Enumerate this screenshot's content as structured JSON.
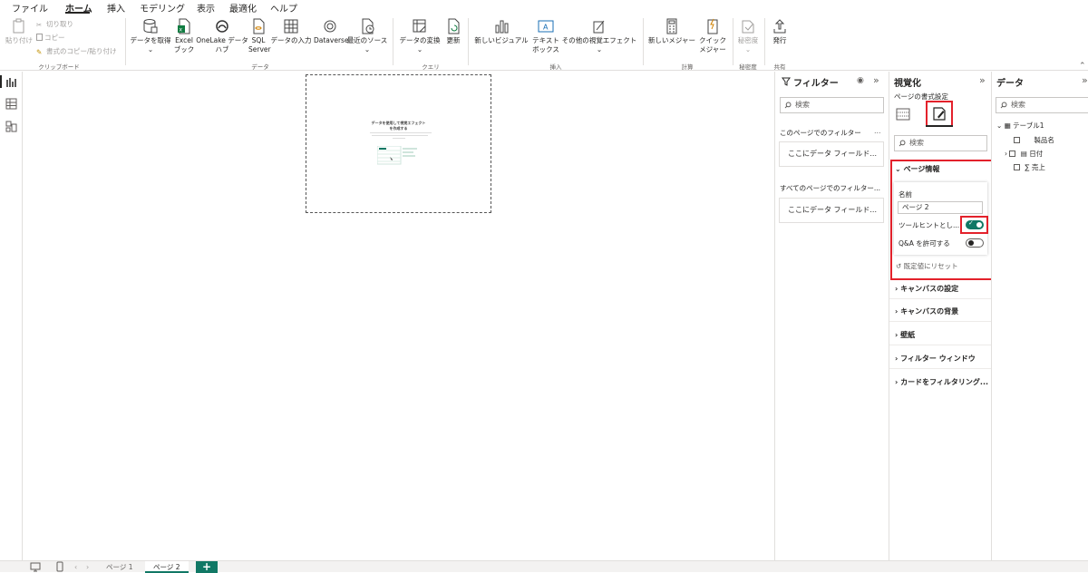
{
  "menu": {
    "items": [
      "ファイル",
      "ホーム",
      "挿入",
      "モデリング",
      "表示",
      "最適化",
      "ヘルプ"
    ],
    "active": "ホーム"
  },
  "ribbon": {
    "clipboard": {
      "paste_label": "貼り付け",
      "cut_label": "切り取り",
      "copy_label": "コピー",
      "format_painter_label": "書式のコピー/貼り付け",
      "group_label": "クリップボード"
    },
    "data": {
      "get_data": "データを取得",
      "excel_line1": "Excel",
      "excel_line2": "ブック",
      "onelake_line1": "OneLake データ",
      "onelake_line2": "ハブ",
      "sql_line1": "SQL",
      "sql_line2": "Server",
      "enter_data": "データの入力",
      "dataverse": "Dataverse",
      "recent_sources": "最近のソース",
      "group_label": "データ"
    },
    "query": {
      "transform": "データの変換",
      "refresh": "更新",
      "group_label": "クエリ"
    },
    "insert": {
      "new_visual": "新しいビジュアル",
      "textbox_line1": "テキスト",
      "textbox_line2": "ボックス",
      "more_visuals": "その他の視覚エフェクト",
      "group_label": "挿入"
    },
    "calc": {
      "new_measure": "新しいメジャー",
      "quick_line1": "クイック",
      "quick_line2": "メジャー",
      "group_label": "計算"
    },
    "sensitivity": {
      "label": "秘密度",
      "group_label": "秘密度"
    },
    "share": {
      "publish": "発行",
      "group_label": "共有"
    }
  },
  "canvas": {
    "placeholder_title_line1": "データを使用して視覚エフェクト",
    "placeholder_title_line2": "を作成する"
  },
  "pages": {
    "tabs": [
      "ページ 1",
      "ページ 2"
    ],
    "active": "ページ 2",
    "add_label": "+"
  },
  "filters": {
    "title": "フィルター",
    "search_placeholder": "検索",
    "this_page": "このページでのフィルター",
    "this_page_more": "…",
    "this_page_drop": "ここにデータ フィールド...",
    "all_pages": "すべてのページでのフィルター...",
    "all_pages_drop": "ここにデータ フィールド..."
  },
  "viz": {
    "title": "視覚化",
    "subtitle": "ページの書式設定",
    "search_placeholder": "検索",
    "page_info": {
      "header": "ページ情報",
      "name_label": "名前",
      "name_value": "ページ 2",
      "tooltip_label": "ツールヒントとし...",
      "tooltip_on": true,
      "qa_label": "Q&A を許可する",
      "qa_on": false,
      "reset_label": "既定値にリセット"
    },
    "sections": [
      "キャンバスの設定",
      "キャンバスの背景",
      "壁紙",
      "フィルター ウィンドウ",
      "カードをフィルタリング..."
    ]
  },
  "data_pane": {
    "title": "データ",
    "search_placeholder": "検索",
    "table": "テーブル1",
    "fields": [
      {
        "name": "製品名",
        "expandable": false,
        "icon": "none"
      },
      {
        "name": "日付",
        "expandable": true,
        "icon": "calendar-icon"
      },
      {
        "name": "売上",
        "expandable": false,
        "icon": "sigma-icon"
      }
    ]
  },
  "colors": {
    "accent": "#117865",
    "highlight_red": "#e3212b",
    "excel_green": "#107c41"
  }
}
